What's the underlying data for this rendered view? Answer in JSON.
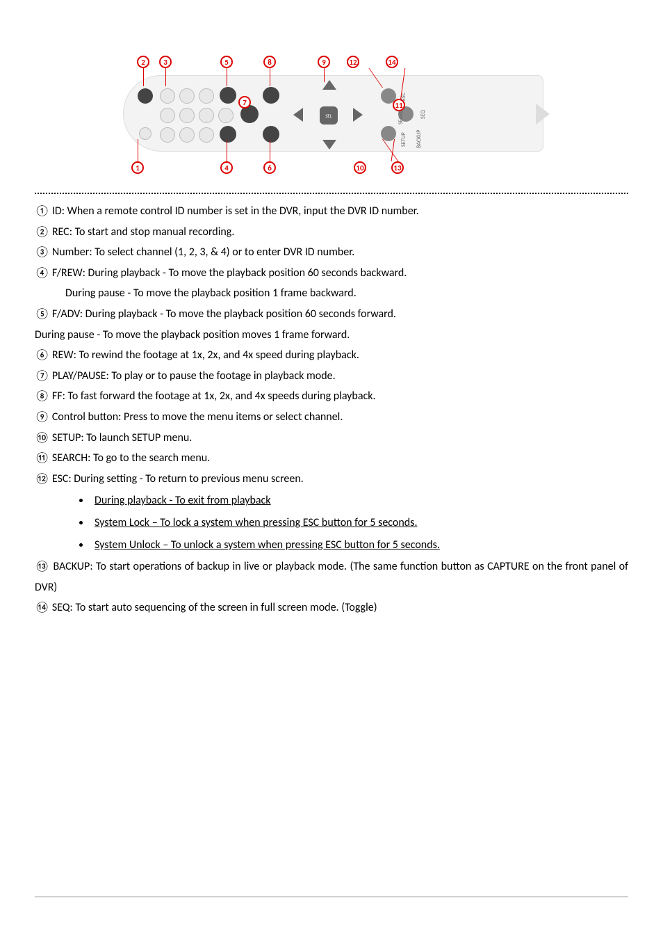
{
  "diagram": {
    "dpad_center": "SEL",
    "side_labels": {
      "esc": "ESC",
      "search": "SEARCH",
      "seq": "SEQ",
      "setup": "SETUP",
      "backup": "BACKUP"
    }
  },
  "callouts_top": {
    "c2": "2",
    "c3": "3",
    "c5": "5",
    "c8": "8",
    "c9": "9",
    "c12": "12",
    "c14": "14"
  },
  "callouts_bottom": {
    "c1": "1",
    "c4": "4",
    "c6": "6",
    "c7": "7",
    "c10": "10",
    "c11": "11",
    "c13": "13"
  },
  "items": {
    "i1": "① ID: When a remote control ID number is set in the DVR, input the DVR ID number.",
    "i2": "② REC: To start and stop manual recording.",
    "i3": "③ Number: To select channel (1, 2, 3, & 4) or to enter DVR ID number.",
    "i4": "④ F/REW: During playback - To move the playback position 60 seconds backward.",
    "i4b": "During pause - To move the playback position 1 frame backward.",
    "i5": "⑤ F/ADV: During playback - To move the playback position 60 seconds forward.",
    "i5b": "During pause - To move the playback position moves 1 frame forward.",
    "i6": "⑥ REW: To rewind the footage at 1x, 2x, and 4x speed during playback.",
    "i7": "⑦ PLAY/PAUSE: To play or to pause the footage in playback mode.",
    "i8": "⑧ FF: To fast forward the footage at 1x, 2x, and 4x speeds during playback.",
    "i9": "⑨ Control button: Press to move the menu items or select channel.",
    "i10": "⑩ SETUP: To launch SETUP menu.",
    "i11": "⑪ SEARCH: To go to the search menu.",
    "i12": "⑫ ESC: During setting - To return to previous menu screen.",
    "b1": "During playback - To exit from playback",
    "b2": "System Lock – To lock a system when pressing ESC button for 5 seconds. ",
    "b3": "System Unlock – To unlock a system when pressing ESC button for 5 seconds. ",
    "i13": "⑬ BACKUP: To start operations of backup in live or playback mode. (The same function button as CAPTURE on the front panel of DVR)",
    "i14": "⑭ SEQ: To start auto sequencing of the screen in full screen mode. (Toggle)"
  }
}
